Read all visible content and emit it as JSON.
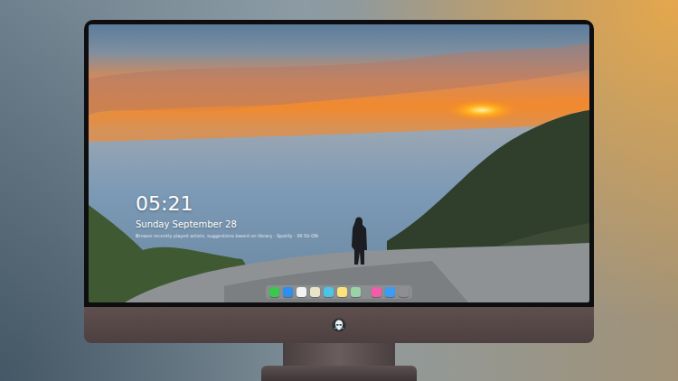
{
  "lock_screen": {
    "time": "05:21",
    "date": "Sunday September 28",
    "notice": "Browse recently played artists, suggestions based on library · Spotify · 36 Sit·ON"
  },
  "dock": {
    "items": [
      {
        "color": "#3cc74e"
      },
      {
        "color": "#2f8ef0"
      },
      {
        "color": "#f2f2f2"
      },
      {
        "color": "#e9e4c8"
      },
      {
        "color": "#4ec3e8"
      },
      {
        "color": "#fbe27a"
      },
      {
        "color": "#9ad3a8"
      },
      {
        "color": "#f25ca8"
      },
      {
        "color": "#3a9cf5"
      },
      {
        "color": "#8e8e93"
      }
    ]
  }
}
